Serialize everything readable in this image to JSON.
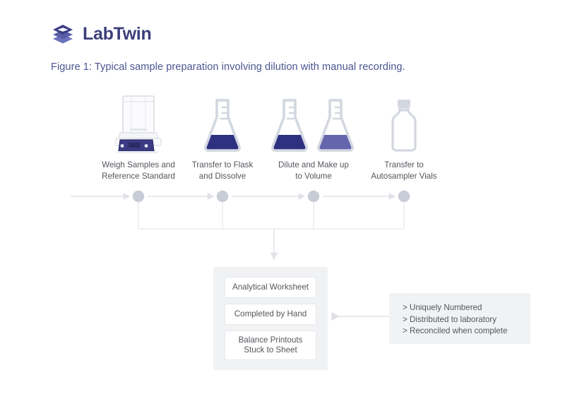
{
  "brand": {
    "name": "LabTwin",
    "logo_icon": "stacked-diamond-logo-icon",
    "logo_color_top": "#3b3f86",
    "logo_color_bottom": "#6c72bb",
    "wordmark_color": "#3c3f7a"
  },
  "figure": {
    "caption": "Figure 1: Typical sample preparation involving dilution with manual recording.",
    "caption_color": "#4c5590"
  },
  "steps": [
    {
      "id": "weigh-samples",
      "icon": "analytical-balance-icon",
      "label": "Weigh Samples and\nReference Standard"
    },
    {
      "id": "transfer-to-flask",
      "icon": "erlenmeyer-flask-icon",
      "label": "Transfer to Flask\nand Dissolve"
    },
    {
      "id": "dilute-make-up-volume",
      "icon": "two-erlenmeyer-flasks-icon",
      "label": "Dilute and Make up\nto Volume"
    },
    {
      "id": "transfer-to-vials",
      "icon": "autosampler-vial-icon",
      "label": "Transfer to\nAutosampler Vials"
    }
  ],
  "timeline": {
    "node_color": "#c8ccd6",
    "line_color": "#dfe2e7",
    "node_count": 4
  },
  "worksheet": {
    "panel_color": "#f1f2f4",
    "items": [
      {
        "id": "analytical-worksheet",
        "label": "Analytical Worksheet"
      },
      {
        "id": "completed-by-hand",
        "label": "Completed by Hand"
      },
      {
        "id": "balance-printouts",
        "label": "Balance Printouts\nStuck to Sheet"
      }
    ]
  },
  "notes": {
    "panel_color": "#f1f2f4",
    "lines": [
      "> Uniquely Numbered",
      "> Distributed to laboratory",
      "> Reconciled when complete"
    ]
  },
  "colors": {
    "liquid_dark": "#2e3180",
    "liquid_light": "#6366ad",
    "glass_outline": "#d3d7e0",
    "text_body": "#53565c",
    "page_background": "#ffffff"
  }
}
